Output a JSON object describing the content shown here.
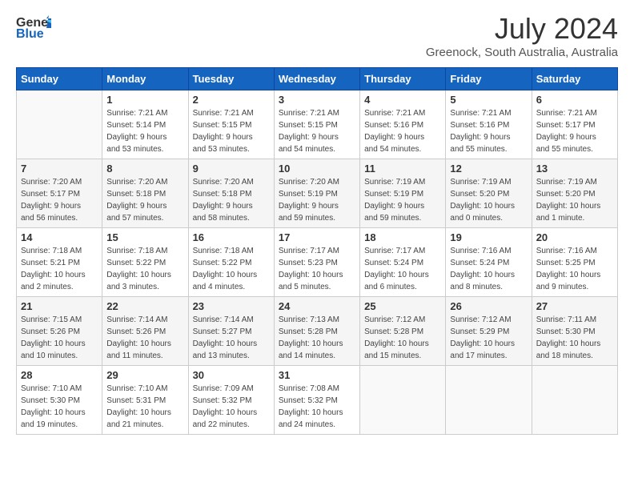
{
  "header": {
    "logo_general": "General",
    "logo_blue": "Blue",
    "month": "July 2024",
    "location": "Greenock, South Australia, Australia"
  },
  "weekdays": [
    "Sunday",
    "Monday",
    "Tuesday",
    "Wednesday",
    "Thursday",
    "Friday",
    "Saturday"
  ],
  "weeks": [
    [
      {
        "day": "",
        "info": ""
      },
      {
        "day": "1",
        "info": "Sunrise: 7:21 AM\nSunset: 5:14 PM\nDaylight: 9 hours\nand 53 minutes."
      },
      {
        "day": "2",
        "info": "Sunrise: 7:21 AM\nSunset: 5:15 PM\nDaylight: 9 hours\nand 53 minutes."
      },
      {
        "day": "3",
        "info": "Sunrise: 7:21 AM\nSunset: 5:15 PM\nDaylight: 9 hours\nand 54 minutes."
      },
      {
        "day": "4",
        "info": "Sunrise: 7:21 AM\nSunset: 5:16 PM\nDaylight: 9 hours\nand 54 minutes."
      },
      {
        "day": "5",
        "info": "Sunrise: 7:21 AM\nSunset: 5:16 PM\nDaylight: 9 hours\nand 55 minutes."
      },
      {
        "day": "6",
        "info": "Sunrise: 7:21 AM\nSunset: 5:17 PM\nDaylight: 9 hours\nand 55 minutes."
      }
    ],
    [
      {
        "day": "7",
        "info": "Sunrise: 7:20 AM\nSunset: 5:17 PM\nDaylight: 9 hours\nand 56 minutes."
      },
      {
        "day": "8",
        "info": "Sunrise: 7:20 AM\nSunset: 5:18 PM\nDaylight: 9 hours\nand 57 minutes."
      },
      {
        "day": "9",
        "info": "Sunrise: 7:20 AM\nSunset: 5:18 PM\nDaylight: 9 hours\nand 58 minutes."
      },
      {
        "day": "10",
        "info": "Sunrise: 7:20 AM\nSunset: 5:19 PM\nDaylight: 9 hours\nand 59 minutes."
      },
      {
        "day": "11",
        "info": "Sunrise: 7:19 AM\nSunset: 5:19 PM\nDaylight: 9 hours\nand 59 minutes."
      },
      {
        "day": "12",
        "info": "Sunrise: 7:19 AM\nSunset: 5:20 PM\nDaylight: 10 hours\nand 0 minutes."
      },
      {
        "day": "13",
        "info": "Sunrise: 7:19 AM\nSunset: 5:20 PM\nDaylight: 10 hours\nand 1 minute."
      }
    ],
    [
      {
        "day": "14",
        "info": "Sunrise: 7:18 AM\nSunset: 5:21 PM\nDaylight: 10 hours\nand 2 minutes."
      },
      {
        "day": "15",
        "info": "Sunrise: 7:18 AM\nSunset: 5:22 PM\nDaylight: 10 hours\nand 3 minutes."
      },
      {
        "day": "16",
        "info": "Sunrise: 7:18 AM\nSunset: 5:22 PM\nDaylight: 10 hours\nand 4 minutes."
      },
      {
        "day": "17",
        "info": "Sunrise: 7:17 AM\nSunset: 5:23 PM\nDaylight: 10 hours\nand 5 minutes."
      },
      {
        "day": "18",
        "info": "Sunrise: 7:17 AM\nSunset: 5:24 PM\nDaylight: 10 hours\nand 6 minutes."
      },
      {
        "day": "19",
        "info": "Sunrise: 7:16 AM\nSunset: 5:24 PM\nDaylight: 10 hours\nand 8 minutes."
      },
      {
        "day": "20",
        "info": "Sunrise: 7:16 AM\nSunset: 5:25 PM\nDaylight: 10 hours\nand 9 minutes."
      }
    ],
    [
      {
        "day": "21",
        "info": "Sunrise: 7:15 AM\nSunset: 5:26 PM\nDaylight: 10 hours\nand 10 minutes."
      },
      {
        "day": "22",
        "info": "Sunrise: 7:14 AM\nSunset: 5:26 PM\nDaylight: 10 hours\nand 11 minutes."
      },
      {
        "day": "23",
        "info": "Sunrise: 7:14 AM\nSunset: 5:27 PM\nDaylight: 10 hours\nand 13 minutes."
      },
      {
        "day": "24",
        "info": "Sunrise: 7:13 AM\nSunset: 5:28 PM\nDaylight: 10 hours\nand 14 minutes."
      },
      {
        "day": "25",
        "info": "Sunrise: 7:12 AM\nSunset: 5:28 PM\nDaylight: 10 hours\nand 15 minutes."
      },
      {
        "day": "26",
        "info": "Sunrise: 7:12 AM\nSunset: 5:29 PM\nDaylight: 10 hours\nand 17 minutes."
      },
      {
        "day": "27",
        "info": "Sunrise: 7:11 AM\nSunset: 5:30 PM\nDaylight: 10 hours\nand 18 minutes."
      }
    ],
    [
      {
        "day": "28",
        "info": "Sunrise: 7:10 AM\nSunset: 5:30 PM\nDaylight: 10 hours\nand 19 minutes."
      },
      {
        "day": "29",
        "info": "Sunrise: 7:10 AM\nSunset: 5:31 PM\nDaylight: 10 hours\nand 21 minutes."
      },
      {
        "day": "30",
        "info": "Sunrise: 7:09 AM\nSunset: 5:32 PM\nDaylight: 10 hours\nand 22 minutes."
      },
      {
        "day": "31",
        "info": "Sunrise: 7:08 AM\nSunset: 5:32 PM\nDaylight: 10 hours\nand 24 minutes."
      },
      {
        "day": "",
        "info": ""
      },
      {
        "day": "",
        "info": ""
      },
      {
        "day": "",
        "info": ""
      }
    ]
  ]
}
